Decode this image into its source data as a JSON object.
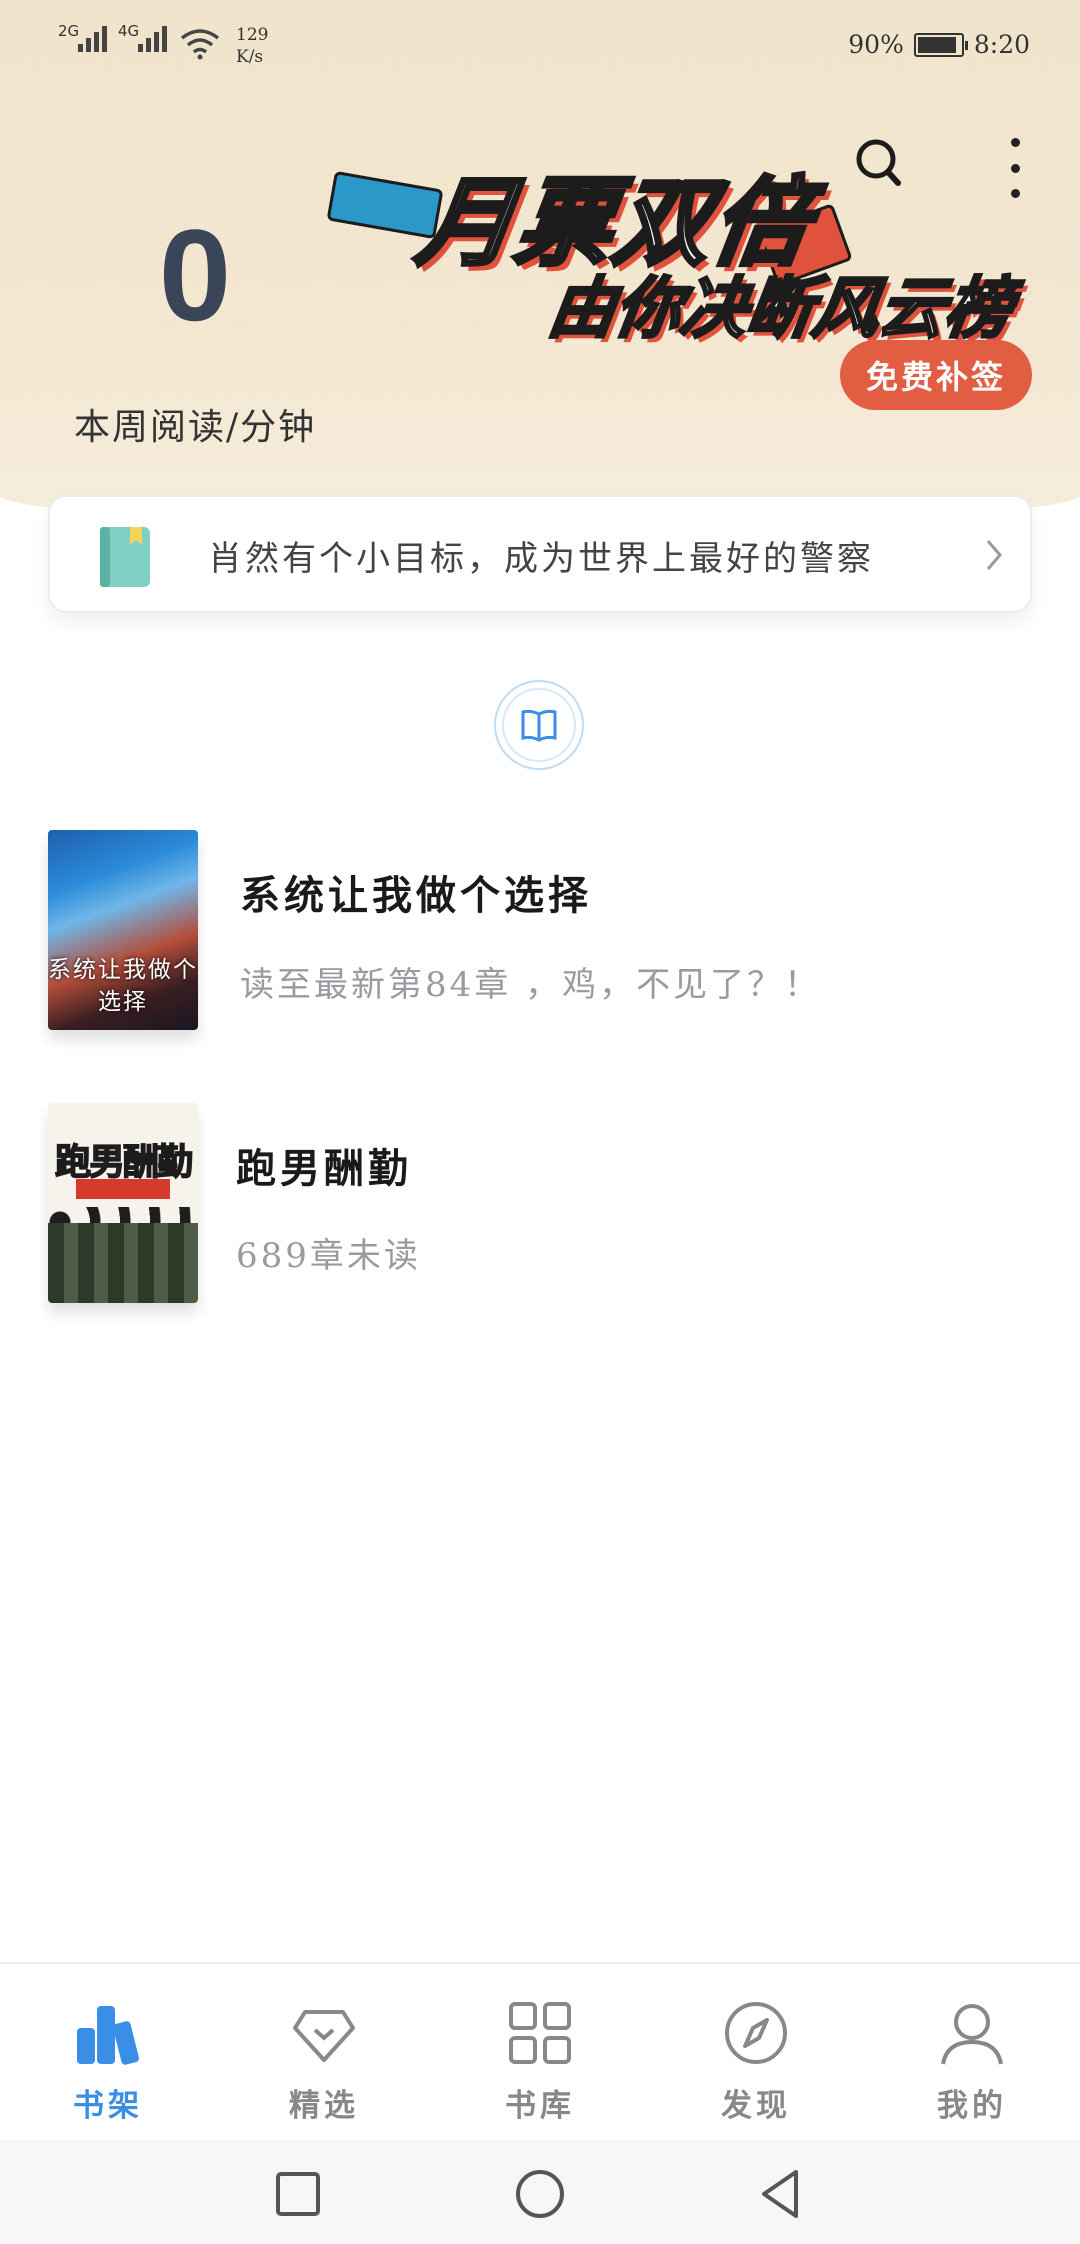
{
  "status_bar": {
    "signal1_label": "2G",
    "signal2_label": "4G",
    "net_speed_value": "129",
    "net_speed_unit": "K/s",
    "battery": "90%",
    "battery_level": 0.9,
    "time": "8:20"
  },
  "header": {
    "weekly_reading_value": "0",
    "weekly_reading_label": "本周阅读/分钟",
    "banner_line1": "月票双倍",
    "banner_line2": "由你决断风云榜",
    "sign_button": "免费补签",
    "search_icon": "search-icon",
    "more_icon": "more-vertical-icon"
  },
  "goal_card": {
    "icon": "book-bookmark-icon",
    "text": "肖然有个小目标，成为世界上最好的警察"
  },
  "books": [
    {
      "title": "系统让我做个选择",
      "subtitle": "读至最新第84章 ，鸡，不见了？！",
      "cover_text": "系统让我做个选择"
    },
    {
      "title": "跑男酬勤",
      "subtitle": "689章未读",
      "cover_text": "跑男酬勤"
    }
  ],
  "bottom_nav": [
    {
      "label": "书架",
      "icon": "bookshelf-icon",
      "active": true
    },
    {
      "label": "精选",
      "icon": "diamond-icon",
      "active": false
    },
    {
      "label": "书库",
      "icon": "grid-icon",
      "active": false
    },
    {
      "label": "发现",
      "icon": "compass-icon",
      "active": false
    },
    {
      "label": "我的",
      "icon": "user-icon",
      "active": false
    }
  ],
  "colors": {
    "accent": "#3b8ee6",
    "sign_button": "#e25e43",
    "header_bg": "#f3e7d1"
  }
}
